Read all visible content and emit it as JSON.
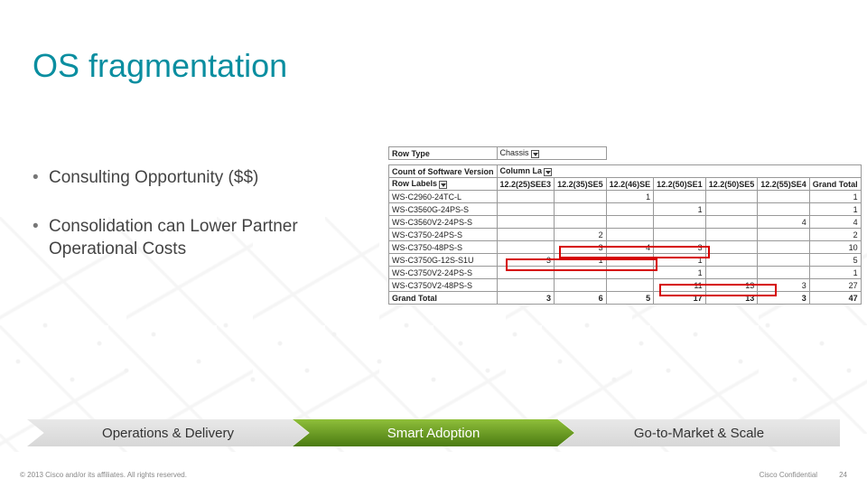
{
  "title": "OS fragmentation",
  "bullets": [
    "Consulting Opportunity ($$)",
    "Consolidation can Lower Partner Operational Costs"
  ],
  "pivot": {
    "filter_label": "Row Type",
    "filter_value": "Chassis",
    "count_label": "Count of Software Version",
    "col_axis_label": "Column La",
    "row_axis_label": "Row Labels",
    "columns": [
      "12.2(25)SEE3",
      "12.2(35)SE5",
      "12.2(46)SE",
      "12.2(50)SE1",
      "12.2(50)SE5",
      "12.2(55)SE4",
      "Grand Total"
    ],
    "rows": [
      {
        "label": "WS-C2960-24TC-L",
        "cells": [
          "",
          "",
          "1",
          "",
          "",
          "",
          "1"
        ]
      },
      {
        "label": "WS-C3560G-24PS-S",
        "cells": [
          "",
          "",
          "",
          "1",
          "",
          "",
          "1"
        ]
      },
      {
        "label": "WS-C3560V2-24PS-S",
        "cells": [
          "",
          "",
          "",
          "",
          "",
          "4",
          "4"
        ]
      },
      {
        "label": "WS-C3750-24PS-S",
        "cells": [
          "",
          "2",
          "",
          "",
          "",
          "",
          "2"
        ]
      },
      {
        "label": "WS-C3750-48PS-S",
        "cells": [
          "",
          "3",
          "4",
          "3",
          "",
          "",
          "10"
        ]
      },
      {
        "label": "WS-C3750G-12S-S1U",
        "cells": [
          "3",
          "1",
          "",
          "1",
          "",
          "",
          "5"
        ]
      },
      {
        "label": "WS-C3750V2-24PS-S",
        "cells": [
          "",
          "",
          "",
          "1",
          "",
          "",
          "1"
        ]
      },
      {
        "label": "WS-C3750V2-48PS-S",
        "cells": [
          "",
          "",
          "",
          "11",
          "13",
          "3",
          "27"
        ]
      }
    ],
    "grand_total": {
      "label": "Grand Total",
      "cells": [
        "3",
        "6",
        "5",
        "17",
        "13",
        "3",
        "47"
      ]
    }
  },
  "chevrons": [
    "Operations & Delivery",
    "Smart Adoption",
    "Go-to-Market & Scale"
  ],
  "footer": {
    "copyright": "© 2013 Cisco and/or its affiliates. All rights reserved.",
    "confidential": "Cisco Confidential",
    "page": "24"
  }
}
